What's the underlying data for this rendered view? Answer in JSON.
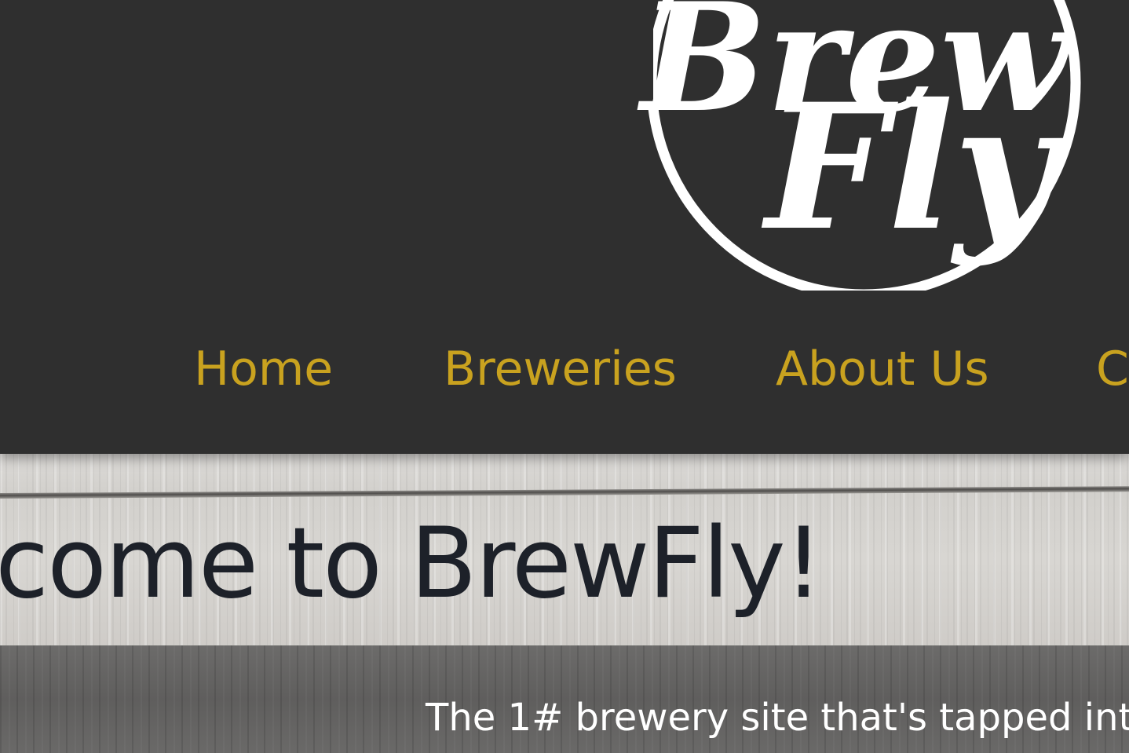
{
  "brand": {
    "logo_line1": "Brew",
    "logo_line2": "Fly",
    "logo_color": "#ffffff"
  },
  "nav": {
    "items": [
      {
        "label": "Home"
      },
      {
        "label": "Breweries"
      },
      {
        "label": "About Us"
      },
      {
        "label": "C"
      }
    ],
    "link_color": "#c9a21f"
  },
  "hero": {
    "title": "come to BrewFly!",
    "title_color": "#1d2129"
  },
  "tagline": {
    "text": "The 1# brewery site that's tapped int",
    "color": "#ffffff"
  },
  "colors": {
    "header_bg": "#2f2f2f"
  }
}
